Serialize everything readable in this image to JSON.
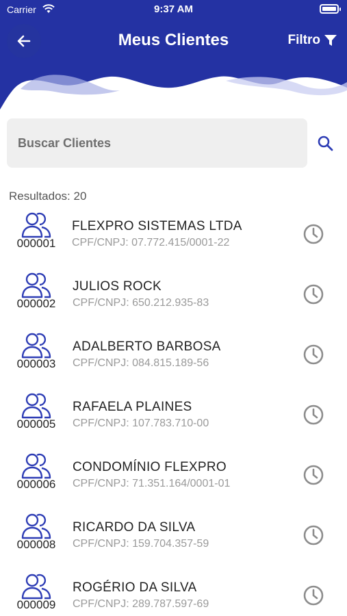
{
  "status_bar": {
    "carrier": "Carrier",
    "time": "9:37 AM"
  },
  "header": {
    "title": "Meus Clientes",
    "filter_label": "Filtro"
  },
  "search": {
    "placeholder": "Buscar Clientes",
    "value": ""
  },
  "results_label": "Resultados: 20",
  "clients": [
    {
      "code": "000001",
      "name": "FLEXPRO SISTEMAS LTDA",
      "doc": "CPF/CNPJ: 07.772.415/0001-22"
    },
    {
      "code": "000002",
      "name": "JULIOS ROCK",
      "doc": "CPF/CNPJ: 650.212.935-83"
    },
    {
      "code": "000003",
      "name": "ADALBERTO BARBOSA",
      "doc": "CPF/CNPJ: 084.815.189-56"
    },
    {
      "code": "000005",
      "name": "RAFAELA PLAINES",
      "doc": "CPF/CNPJ: 107.783.710-00"
    },
    {
      "code": "000006",
      "name": "CONDOMÍNIO FLEXPRO",
      "doc": "CPF/CNPJ: 71.351.164/0001-01"
    },
    {
      "code": "000008",
      "name": "RICARDO DA SILVA",
      "doc": "CPF/CNPJ: 159.704.357-59"
    },
    {
      "code": "000009",
      "name": "ROGÉRIO DA SILVA",
      "doc": "CPF/CNPJ: 289.787.597-69"
    }
  ],
  "colors": {
    "primary": "#2432a3",
    "icon_blue": "#2e3db5",
    "history_gray": "#8c8c8c"
  },
  "icons": {
    "back": "arrow-left-icon",
    "filter": "funnel-icon",
    "search": "search-icon",
    "avatar": "users-icon",
    "history": "clock-icon"
  }
}
